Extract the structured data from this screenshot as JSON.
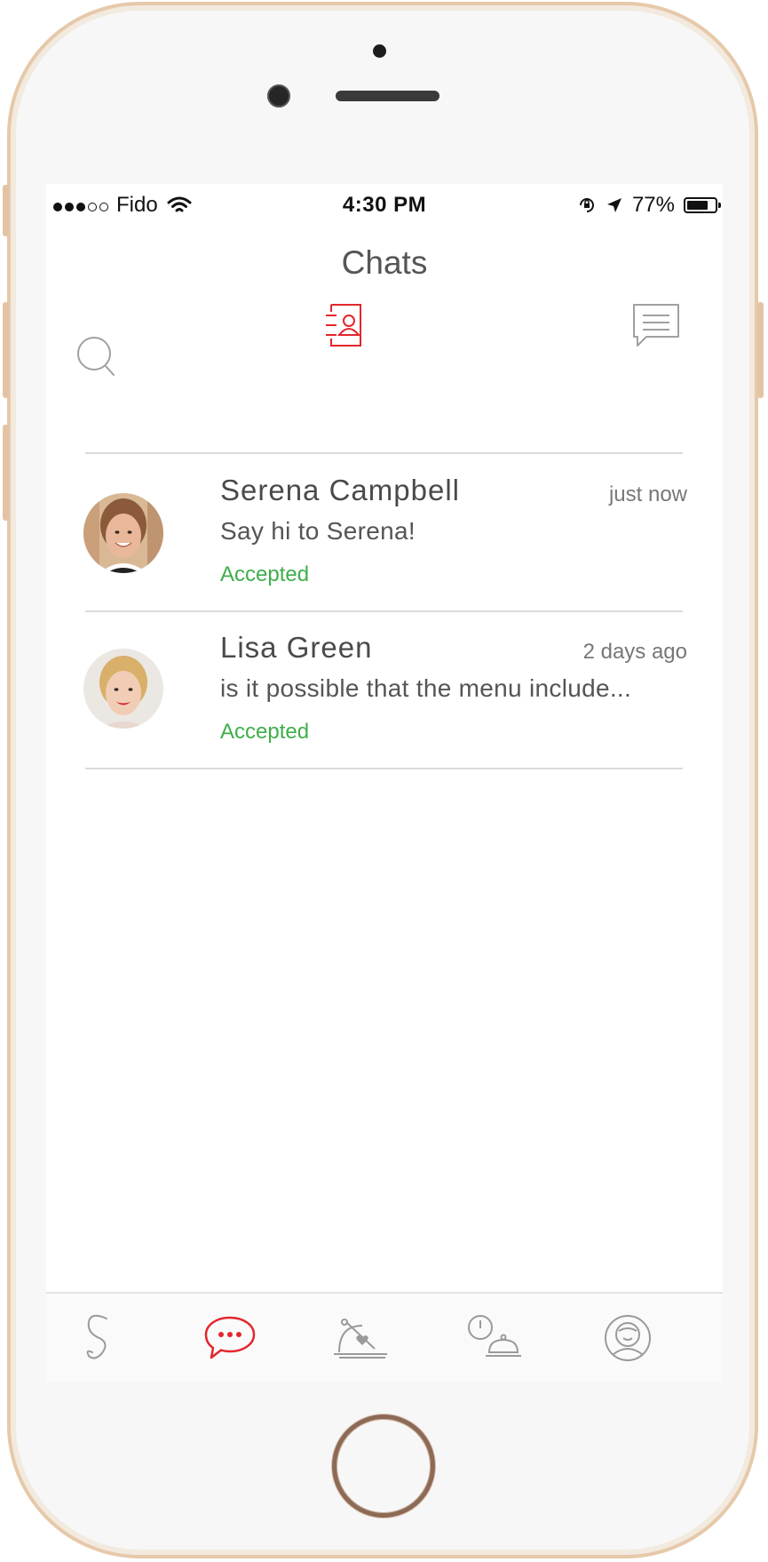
{
  "status_bar": {
    "signal_bars_filled": 3,
    "signal_bars_total": 5,
    "carrier": "Fido",
    "time": "4:30 PM",
    "battery": "77%",
    "battery_level": 0.77
  },
  "header": {
    "title": "Chats"
  },
  "toolbar": {
    "icons": [
      "search-icon",
      "contacts-icon",
      "new-message-icon"
    ],
    "active": "contacts-icon"
  },
  "chats": [
    {
      "name": "Serena Campbell",
      "time": "just now",
      "message": "Say hi to Serena!",
      "status": "Accepted"
    },
    {
      "name": "Lisa Green",
      "time": "2 days ago",
      "message": "is it possible that the menu include...",
      "status": "Accepted"
    }
  ],
  "tab_bar": {
    "tabs": [
      "home-s-logo-icon",
      "chats-bubble-icon",
      "food-cloche-heart-icon",
      "timed-dish-icon",
      "profile-face-icon"
    ],
    "active": "chats-bubble-icon"
  },
  "colors": {
    "accent": "#e4262c",
    "accepted": "#3fae4c",
    "icon_gray": "#9a9a9a",
    "phone_frame": "#e6c9aa"
  }
}
